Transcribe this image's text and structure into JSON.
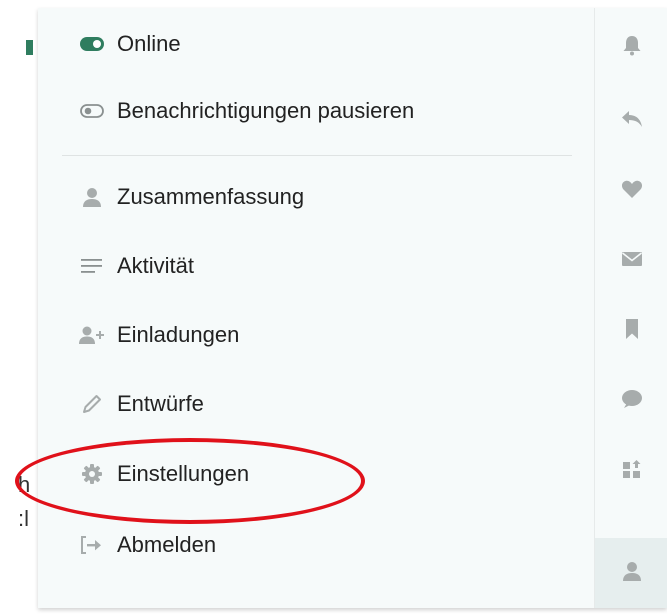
{
  "background": {
    "fragment_1": "h",
    "fragment_2": ":l"
  },
  "menu": {
    "status": [
      {
        "label": "Online",
        "icon": "toggle-on-icon"
      },
      {
        "label": "Benachrichtigungen pausieren",
        "icon": "toggle-off-icon"
      }
    ],
    "items": [
      {
        "label": "Zusammenfassung",
        "icon": "user-icon"
      },
      {
        "label": "Aktivität",
        "icon": "list-icon"
      },
      {
        "label": "Einladungen",
        "icon": "user-plus-icon"
      },
      {
        "label": "Entwürfe",
        "icon": "pencil-icon"
      },
      {
        "label": "Einstellungen",
        "icon": "gear-icon"
      },
      {
        "label": "Abmelden",
        "icon": "sign-out-icon"
      }
    ]
  },
  "rail": {
    "icons": [
      "bell-icon",
      "reply-icon",
      "heart-icon",
      "envelope-icon",
      "bookmark-icon",
      "chat-icon",
      "grid-icon",
      "user-icon"
    ],
    "active": "user-icon"
  },
  "colors": {
    "toggle_on": "#2f7d5f",
    "icon_gray": "#a7acac",
    "highlight": "#e0111a",
    "panel_bg": "#f6fafa"
  }
}
